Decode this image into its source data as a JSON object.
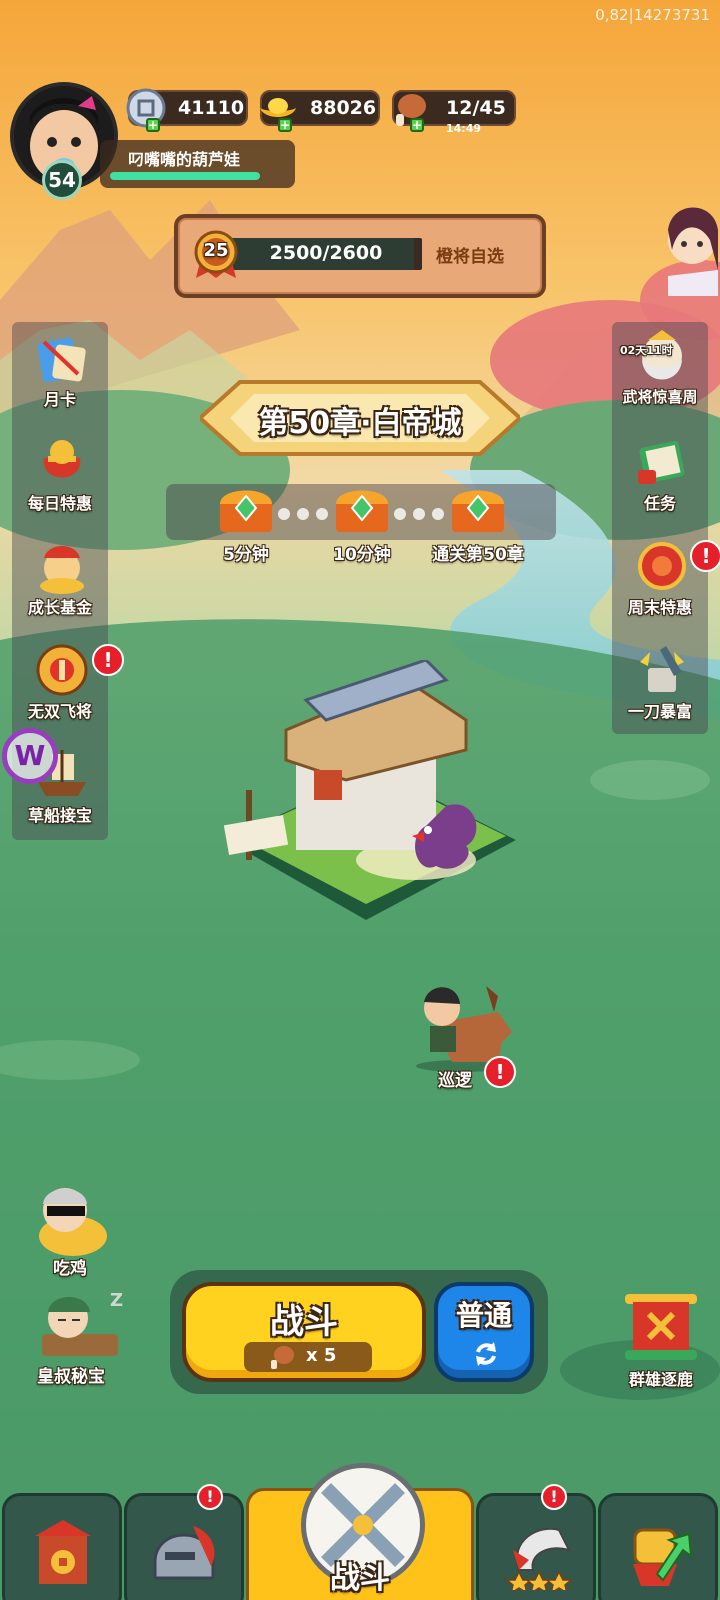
{
  "debug_text": "0,82|14273731",
  "player": {
    "level": "54",
    "name": "叼嘴嘴的葫芦娃"
  },
  "resources": {
    "silver": "41110",
    "gold": "88026",
    "stamina": "12/45",
    "stamina_timer": "14:49"
  },
  "rank_bar": {
    "level": "25",
    "progress": "2500/2600",
    "button": "橙将自选",
    "fill": 0.96
  },
  "chapter": {
    "title": "第50章·白帝城"
  },
  "chests": [
    {
      "label": "5分钟"
    },
    {
      "label": "10分钟"
    },
    {
      "label": "通关第50章"
    }
  ],
  "left_menu": [
    {
      "label": "月卡",
      "icon": "month-card-icon"
    },
    {
      "label": "每日特惠",
      "icon": "gift-bag-icon"
    },
    {
      "label": "成长基金",
      "icon": "growth-fund-icon"
    },
    {
      "label": "无双飞将",
      "icon": "warrior-wheel-icon"
    },
    {
      "label": "草船接宝",
      "icon": "straw-boat-icon"
    }
  ],
  "right_menu": [
    {
      "label": "武将惊喜周",
      "icon": "general-surprise-icon",
      "timer": "02天11时"
    },
    {
      "label": "任务",
      "icon": "task-scroll-icon"
    },
    {
      "label": "周末特惠",
      "icon": "weekend-deal-icon"
    },
    {
      "label": "一刀暴富",
      "icon": "one-slash-icon"
    }
  ],
  "patrol": {
    "label": "巡逻"
  },
  "eat_chicken": {
    "label": "吃鸡"
  },
  "uncle_treasure": {
    "label": "皇叔秘宝",
    "zz": "Z"
  },
  "battle_button": {
    "label": "战斗",
    "cost": "x 5"
  },
  "mode_button": {
    "label": "普通"
  },
  "heroes_race": {
    "label": "群雄逐鹿"
  },
  "bottom_tabs": {
    "active_label": "战斗"
  },
  "colors": {
    "sky": "#f6a93a",
    "ground": "#3f8f62",
    "battle_yellow": "#ffd21f",
    "mode_blue": "#1e86e8",
    "alert_red": "#e5202a"
  }
}
